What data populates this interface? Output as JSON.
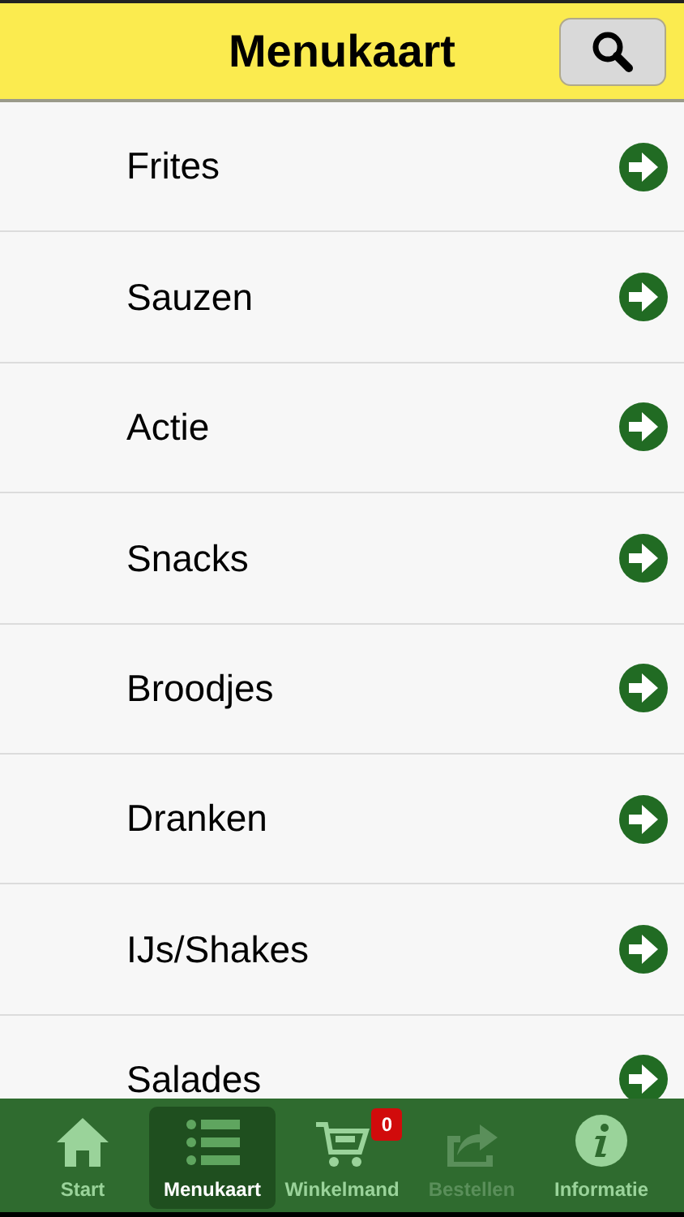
{
  "header": {
    "title": "Menukaart"
  },
  "menu_items": [
    {
      "label": "Frites"
    },
    {
      "label": "Sauzen"
    },
    {
      "label": "Actie"
    },
    {
      "label": "Snacks"
    },
    {
      "label": "Broodjes"
    },
    {
      "label": "Dranken"
    },
    {
      "label": "IJs/Shakes"
    },
    {
      "label": "Salades"
    }
  ],
  "tab_bar": [
    {
      "kind": "home",
      "label": "Start",
      "selected": false,
      "disabled": false
    },
    {
      "kind": "list",
      "label": "Menukaart",
      "selected": true,
      "disabled": false
    },
    {
      "kind": "cart",
      "label": "Winkelmand",
      "selected": false,
      "disabled": false,
      "badge": "0"
    },
    {
      "kind": "share",
      "label": "Bestellen",
      "selected": false,
      "disabled": true
    },
    {
      "kind": "info",
      "label": "Informatie",
      "selected": false,
      "disabled": false
    }
  ]
}
